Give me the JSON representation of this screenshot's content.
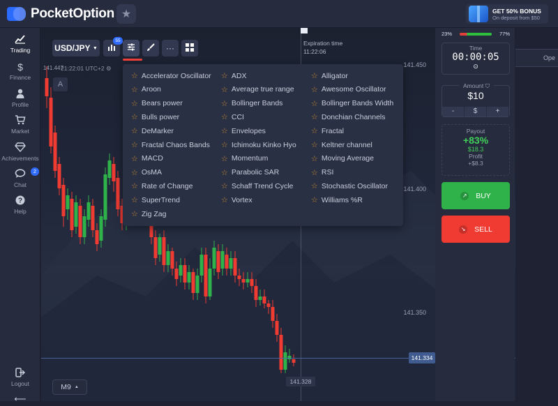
{
  "brand": {
    "name": "PocketOption"
  },
  "bonus": {
    "title": "GET 50% BONUS",
    "subtitle": "On deposit from $50"
  },
  "sidebar": {
    "items": [
      {
        "label": "Trading",
        "icon": "chart-icon"
      },
      {
        "label": "Finance",
        "icon": "dollar-icon"
      },
      {
        "label": "Profile",
        "icon": "user-icon"
      },
      {
        "label": "Market",
        "icon": "cart-icon"
      },
      {
        "label": "Achievements",
        "icon": "diamond-icon"
      },
      {
        "label": "Chat",
        "icon": "chat-icon",
        "badge": "2"
      },
      {
        "label": "Help",
        "icon": "help-icon"
      }
    ],
    "logout": "Logout"
  },
  "toolbar": {
    "pair": "USD/JPY",
    "indicator_count": "55"
  },
  "chart": {
    "timezone": "21:22:01 UTC+2",
    "price_top_left": "141.447",
    "prices": [
      "141.450",
      "141.400",
      "141.350"
    ],
    "expiration_label": "Expiration time",
    "expiration_time": "11:22:06",
    "current_price": "141.334",
    "low_price": "141.328",
    "timeframe": "M9",
    "a_button": "A"
  },
  "indicators": {
    "col1": [
      "Accelerator Oscillator",
      "Aroon",
      "Bears power",
      "Bulls power",
      "DeMarker",
      "Fractal Chaos Bands",
      "MACD",
      "OsMA",
      "Rate of Change",
      "SuperTrend",
      "Zig Zag"
    ],
    "col2": [
      "ADX",
      "Average true range",
      "Bollinger Bands",
      "CCI",
      "Envelopes",
      "Ichimoku Kinko Hyo",
      "Momentum",
      "Parabolic SAR",
      "Schaff Trend Cycle",
      "Vortex"
    ],
    "col3": [
      "Alligator",
      "Awesome Oscillator",
      "Bollinger Bands Width",
      "Donchian Channels",
      "Fractal",
      "Keltner channel",
      "Moving Average",
      "RSI",
      "Stochastic Oscillator",
      "Williams %R"
    ]
  },
  "trade": {
    "sentiment_down": "23%",
    "sentiment_up": "77%",
    "sentiment_up_fraction": 0.77,
    "time_label": "Time",
    "time_value": "00:00:05",
    "amount_label": "Amount",
    "amount_value": "$10",
    "minus": "-",
    "currency": "$",
    "plus": "+",
    "payout_label": "Payout",
    "payout_pct": "+83%",
    "payout_amount": "$18.3",
    "profit_label": "Profit",
    "profit_value": "+$8.3",
    "buy": "BUY",
    "sell": "SELL"
  },
  "right_panel": {
    "tab": "Ope"
  },
  "colors": {
    "bull": "#2fb24a",
    "bear": "#ef3b32",
    "accent": "#2f6bff"
  }
}
